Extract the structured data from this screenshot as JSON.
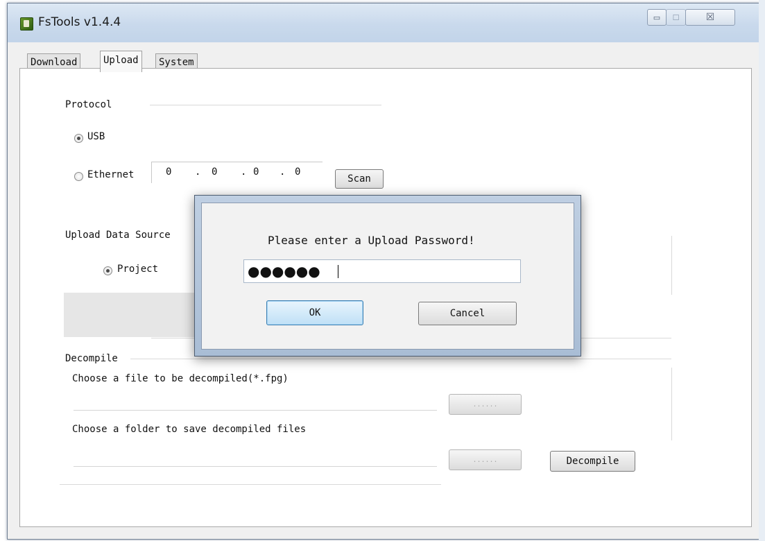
{
  "window": {
    "title": "FsTools v1.4.4",
    "close_glyph": "☒",
    "minimize_glyph": "▭",
    "maximize_glyph": "☐"
  },
  "tabs": [
    {
      "label": "Download",
      "selected": false
    },
    {
      "label": "Upload",
      "selected": true
    },
    {
      "label": "System",
      "selected": false
    }
  ],
  "protocol": {
    "label": "Protocol",
    "usb_label": "USB",
    "usb_checked": true,
    "ethernet_label": "Ethernet",
    "ethernet_checked": false,
    "ip": [
      "0",
      "0",
      "0",
      "0"
    ],
    "ip_separator": ".",
    "scan_label": "Scan"
  },
  "upload_source": {
    "label": "Upload Data Source",
    "project_label": "Project",
    "project_checked": true
  },
  "decompile": {
    "label": "Decompile",
    "file_prompt": "Choose a file to be decompiled(*.fpg)",
    "folder_prompt": "Choose a folder to save decompiled files",
    "browse_label": "......",
    "decompile_label": "Decompile"
  },
  "dialog": {
    "prompt": "Please enter a Upload Password!",
    "password_mask": "●●●●●●",
    "ok_label": "OK",
    "cancel_label": "Cancel"
  },
  "colors": {
    "titlebar": "#c9d9ec",
    "dialog_frame": "#b3c6dc",
    "ok_focus": "#3c7fb1"
  }
}
